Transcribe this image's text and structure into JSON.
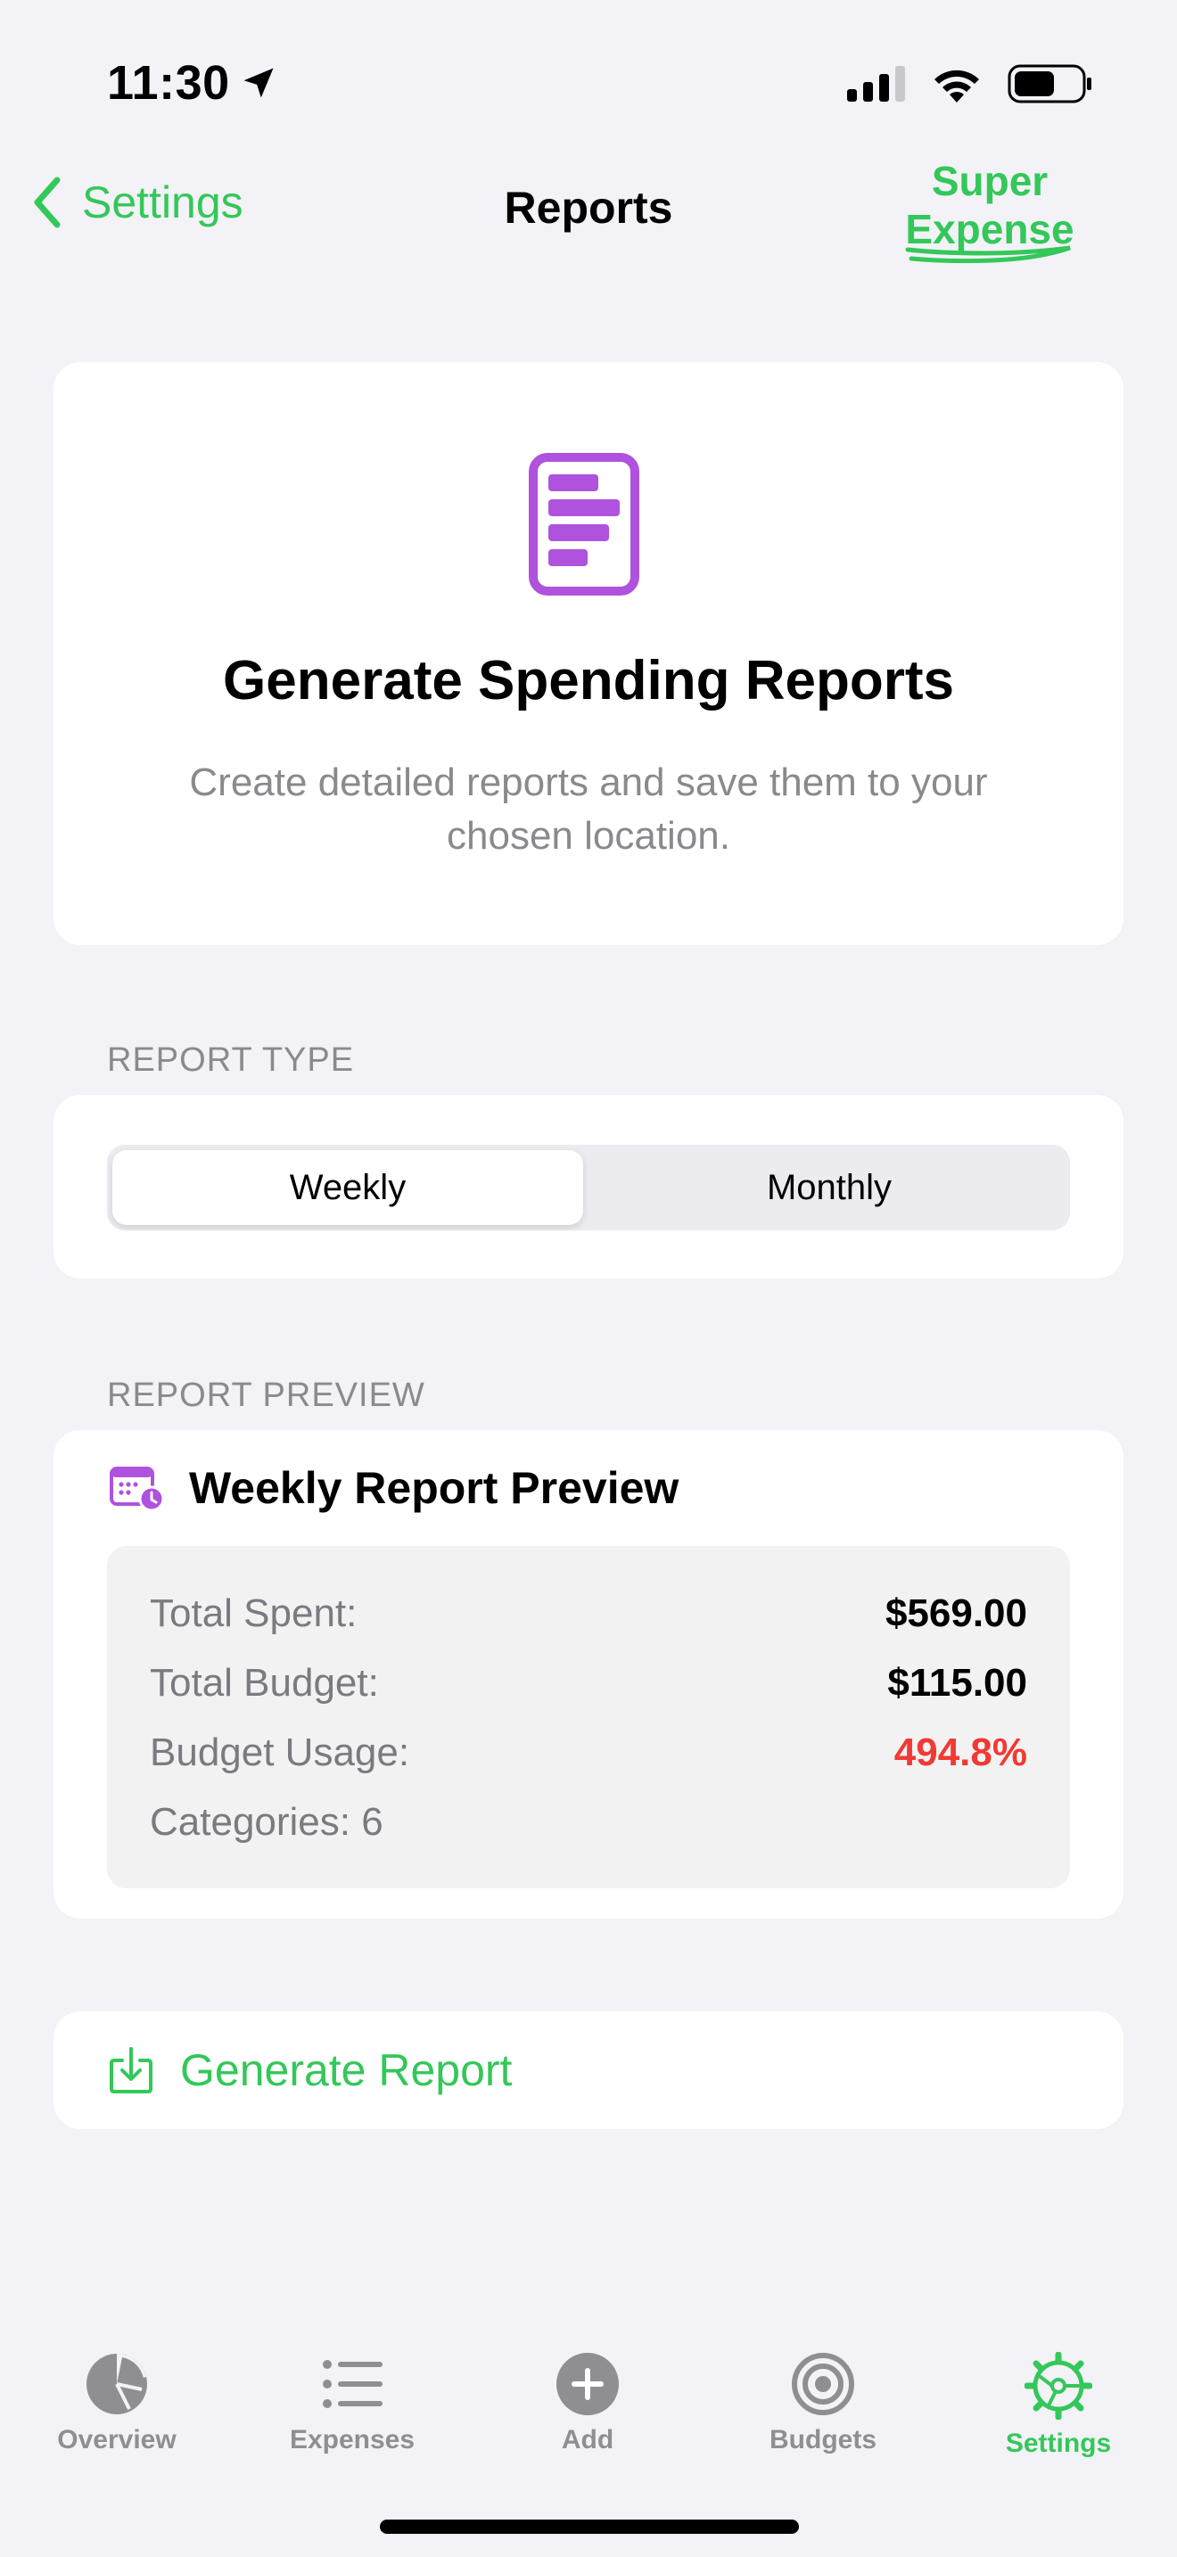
{
  "status_bar": {
    "time": "11:30"
  },
  "nav": {
    "back_label": "Settings",
    "title": "Reports",
    "brand_line1": "Super",
    "brand_line2": "Expense"
  },
  "hero": {
    "title": "Generate Spending Reports",
    "subtitle": "Create detailed reports and save them to your chosen location.",
    "icon": "document-report-icon",
    "icon_color": "#AF52DE"
  },
  "report_type": {
    "section_label": "REPORT TYPE",
    "options": [
      "Weekly",
      "Monthly"
    ],
    "selected": "Weekly"
  },
  "report_preview": {
    "section_label": "REPORT PREVIEW",
    "title": "Weekly Report Preview",
    "icon": "calendar-clock-icon",
    "rows": [
      {
        "label": "Total Spent:",
        "value": "$569.00"
      },
      {
        "label": "Total Budget:",
        "value": "$115.00"
      },
      {
        "label": "Budget Usage:",
        "value": "494.8%",
        "color": "#F03A34"
      },
      {
        "label": "Categories: 6",
        "value": ""
      }
    ]
  },
  "generate": {
    "label": "Generate Report",
    "icon": "download-icon"
  },
  "tabs": [
    {
      "label": "Overview",
      "icon": "pie-chart-icon",
      "active": false
    },
    {
      "label": "Expenses",
      "icon": "list-icon",
      "active": false
    },
    {
      "label": "Add",
      "icon": "plus-circle-icon",
      "active": false
    },
    {
      "label": "Budgets",
      "icon": "target-icon",
      "active": false
    },
    {
      "label": "Settings",
      "icon": "gear-icon",
      "active": true
    }
  ],
  "colors": {
    "accent": "#34C759",
    "purple": "#AF52DE",
    "danger": "#F03A34",
    "background": "#F2F2F7"
  }
}
